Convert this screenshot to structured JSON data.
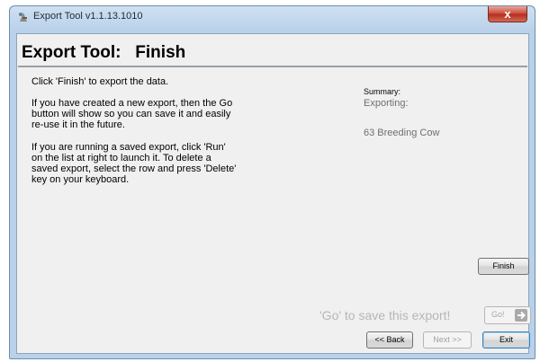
{
  "window": {
    "title": "Export Tool v1.1.13.1010",
    "close_glyph": "x"
  },
  "page": {
    "heading": "Export Tool:   Finish"
  },
  "instructions": {
    "line1": "Click 'Finish' to export the data.",
    "para2": "If you have created a new export, then the Go button will show so you can save it and easily re-use it in the future.",
    "para3": "If you are running a saved export, click 'Run' on the list at right to launch it.  To delete a saved export, select the row and press 'Delete' key on your keyboard."
  },
  "summary": {
    "label": "Summary:",
    "exporting": "Exporting:",
    "item": "63 Breeding Cow"
  },
  "buttons": {
    "finish": "Finish",
    "go_hint": "'Go' to save this export!",
    "go": "Go!",
    "back": "<< Back",
    "next": "Next >>",
    "exit": "Exit"
  },
  "icons": {
    "app": "export-tool-icon",
    "close": "close-icon",
    "go_arrow": "arrow-right-icon"
  },
  "colors": {
    "title_bar": "#b9d1ea",
    "close_button": "#c8483a",
    "dialog_bg": "#f0f0f0",
    "muted_text": "#6f6f6f"
  }
}
